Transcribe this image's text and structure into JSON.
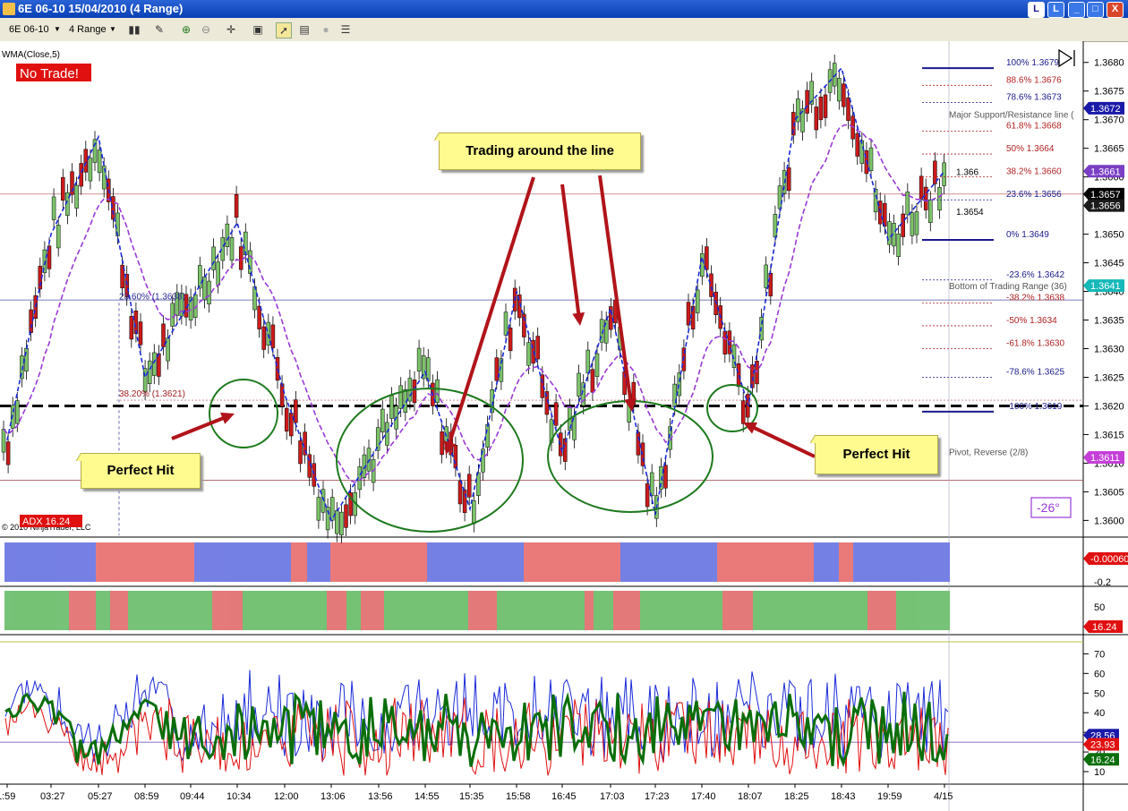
{
  "window": {
    "title": "6E 06-10  15/04/2010 (4 Range)",
    "controls": [
      "L",
      "_",
      "□",
      "X"
    ]
  },
  "toolbar": {
    "instrument": "6E 06-10",
    "period": "4 Range",
    "icons": [
      "bar-type-icon",
      "draw-icon",
      "zoom-in-icon",
      "zoom-out-icon",
      "crosshair-icon",
      "properties-icon",
      "strategy-icon",
      "chart-trader-icon",
      "data-box-icon",
      "list-icon"
    ]
  },
  "chart": {
    "indicator_label": "WMA(Close,5)",
    "no_trade": "No Trade!",
    "copyright": "© 2010 NinjaTrader, LLC",
    "adx_label": "ADX 16.24",
    "angle_label": "-26°",
    "fib_left_23": "23.60% (1.3638)",
    "fib_left_38": "38.20% (1.3621)",
    "label_1366": "1.366",
    "label_13654": "1.3654",
    "major_line_label": "Major Support/Resistance line (",
    "bottom_range_label": "Bottom of Trading Range (36)",
    "pivot_label": "Pivot, Reverse (2/8)",
    "fib_levels": [
      {
        "label": "100%  1.3679",
        "color": "#1a1a8c"
      },
      {
        "label": "88.6%  1.3676",
        "color": "#b22222"
      },
      {
        "label": "78.6%  1.3673",
        "color": "#1a1a8c"
      },
      {
        "label": "61.8%  1.3668",
        "color": "#b22222"
      },
      {
        "label": "50%  1.3664",
        "color": "#b22222"
      },
      {
        "label": "38.2%  1.3660",
        "color": "#b22222"
      },
      {
        "label": "23.6%  1.3656",
        "color": "#1a1a8c"
      },
      {
        "label": "0%  1.3649",
        "color": "#1a1a8c"
      },
      {
        "label": "-23.6%  1.3642",
        "color": "#1a1a8c"
      },
      {
        "label": "-38.2%  1.3638",
        "color": "#b22222"
      },
      {
        "label": "-50%  1.3634",
        "color": "#b22222"
      },
      {
        "label": "-61.8%  1.3630",
        "color": "#b22222"
      },
      {
        "label": "-78.6%  1.3625",
        "color": "#1a1a8c"
      },
      {
        "label": "-100%  1.3619",
        "color": "#1a1a8c"
      }
    ],
    "price_axis": [
      "1.3680",
      "1.3675",
      "1.3670",
      "1.3665",
      "1.3660",
      "1.3655",
      "1.3650",
      "1.3645",
      "1.3640",
      "1.3635",
      "1.3630",
      "1.3625",
      "1.3620",
      "1.3615",
      "1.3610",
      "1.3605",
      "1.3600"
    ],
    "price_badges": [
      {
        "text": "1.3672",
        "color": "#1a1aa8"
      },
      {
        "text": "1.3661",
        "color": "#7a3fc4"
      },
      {
        "text": "1.3657",
        "color": "#000000"
      },
      {
        "text": "1.3656",
        "color": "#1a1a1a"
      },
      {
        "text": "1.3641",
        "color": "#16b8b8"
      },
      {
        "text": "1.3611",
        "color": "#c43fd8"
      }
    ],
    "annotations": {
      "trading_line": "Trading around the line",
      "perfect_hit_left": "Perfect Hit",
      "perfect_hit_right": "Perfect Hit"
    }
  },
  "panel2": {
    "badge": "-0.00060",
    "axis": "-0.2"
  },
  "panel3": {
    "badge": "16.24",
    "axis": "50"
  },
  "panel4": {
    "axis": [
      "70",
      "60",
      "50",
      "40",
      "30",
      "20",
      "10"
    ],
    "badges": [
      {
        "text": "28.56",
        "color": "#1a1aa8"
      },
      {
        "text": "23.93",
        "color": "#e01010"
      },
      {
        "text": "16.24",
        "color": "#0a6e0a"
      }
    ]
  },
  "time_axis": [
    "1:59",
    "03:27",
    "05:27",
    "08:59",
    "09:44",
    "10:34",
    "12:00",
    "13:06",
    "13:56",
    "14:55",
    "15:35",
    "15:58",
    "16:45",
    "17:03",
    "17:23",
    "17:40",
    "18:07",
    "18:25",
    "18:43",
    "19:59",
    "4/15"
  ],
  "chart_data": {
    "type": "candlestick",
    "title": "6E 06-10  15/04/2010 (4 Range)",
    "price_range": [
      1.3597,
      1.3683
    ],
    "support_line": 1.362,
    "fib_retracement": {
      "100%": 1.3679,
      "88.6%": 1.3676,
      "78.6%": 1.3673,
      "61.8%": 1.3668,
      "50%": 1.3664,
      "38.2%": 1.366,
      "23.6%": 1.3656,
      "0%": 1.3649,
      "-23.6%": 1.3642,
      "-38.2%": 1.3638,
      "-50%": 1.3634,
      "-61.8%": 1.363,
      "-78.6%": 1.3625,
      "-100%": 1.3619
    },
    "zigzag_pivots": [
      [
        "1:59",
        1.3614
      ],
      [
        "03:27",
        1.365
      ],
      [
        "05:27",
        1.3667
      ],
      [
        "08:59",
        1.3625
      ],
      [
        "10:34",
        1.3652
      ],
      [
        "12:00",
        1.3622
      ],
      [
        "13:06",
        1.36
      ],
      [
        "14:55",
        1.3626
      ],
      [
        "15:35",
        1.3602
      ],
      [
        "15:58",
        1.364
      ],
      [
        "16:45",
        1.3612
      ],
      [
        "17:03",
        1.3637
      ],
      [
        "17:23",
        1.3601
      ],
      [
        "17:40",
        1.3646
      ],
      [
        "18:07",
        1.362
      ],
      [
        "18:25",
        1.367
      ],
      [
        "18:43",
        1.3679
      ],
      [
        "19:59",
        1.3649
      ],
      [
        "4/15",
        1.3661
      ]
    ],
    "wma_period": 5,
    "adx": 16.24,
    "dmi_plus": 28.56,
    "dmi_minus": 23.93,
    "oscillator_last": -0.0006
  }
}
